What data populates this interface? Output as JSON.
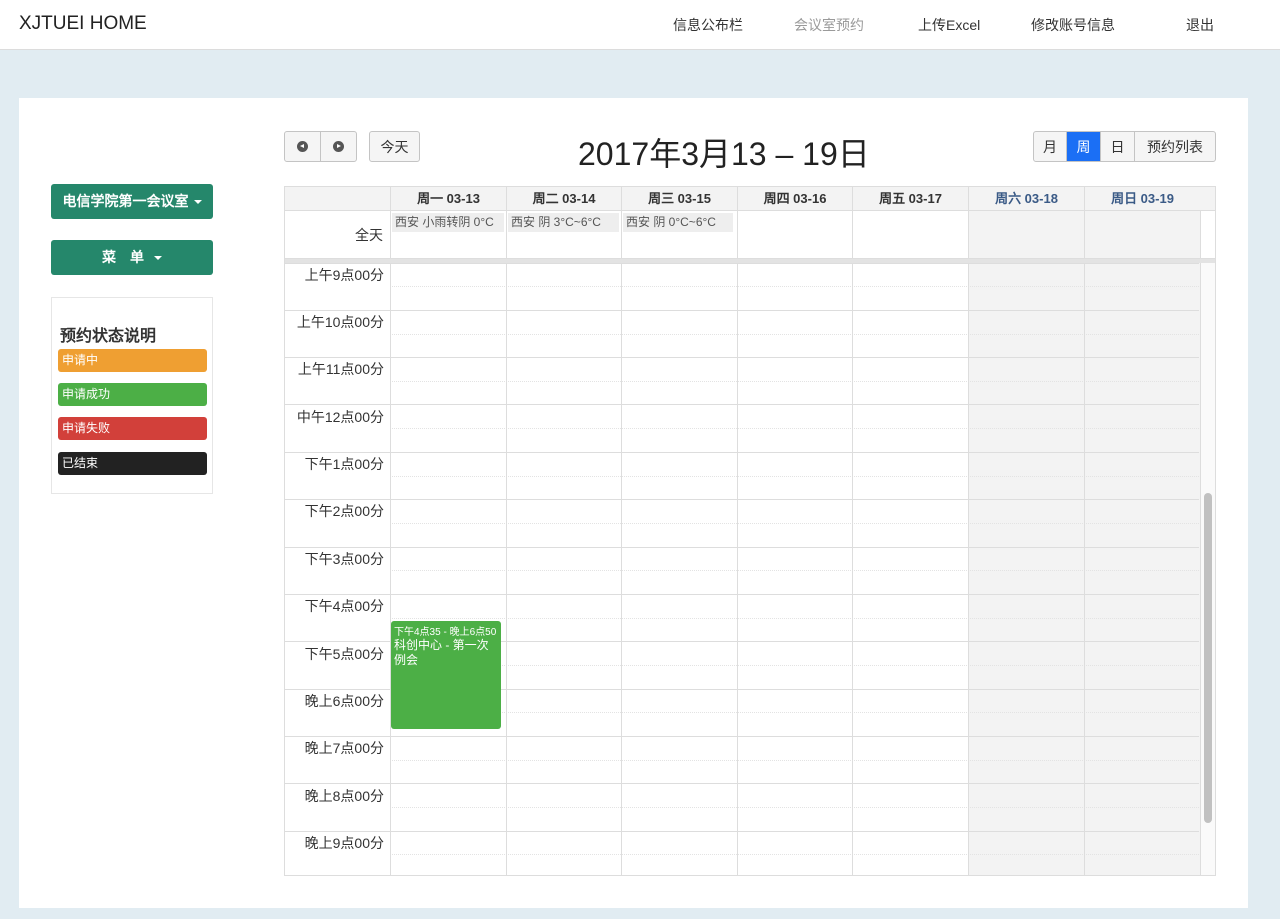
{
  "navbar": {
    "brand": "XJTUEI HOME",
    "items": [
      {
        "label": "信息公布栏",
        "active": false
      },
      {
        "label": "会议室预约",
        "active": true
      },
      {
        "label": "上传Excel",
        "active": false
      },
      {
        "label": "修改账号信息",
        "active": false
      },
      {
        "label": "退出",
        "active": false
      }
    ]
  },
  "sidebar": {
    "room_dropdown": "电信学院第一会议室",
    "menu_dropdown": "菜　单",
    "legend": {
      "title": "预约状态说明",
      "items": [
        {
          "label": "申请中",
          "color": "#ef9f32"
        },
        {
          "label": "申请成功",
          "color": "#4caf46"
        },
        {
          "label": "申请失败",
          "color": "#d2403a"
        },
        {
          "label": "已结束",
          "color": "#222222"
        }
      ]
    }
  },
  "toolbar": {
    "prev_icon": "prev-circle-icon",
    "next_icon": "next-circle-icon",
    "today": "今天",
    "title": "2017年3月13 – 19日",
    "views": [
      {
        "label": "月",
        "active": false
      },
      {
        "label": "周",
        "active": true
      },
      {
        "label": "日",
        "active": false
      },
      {
        "label": "预约列表",
        "active": false
      }
    ]
  },
  "calendar": {
    "days": [
      {
        "label": "周一 03-13",
        "weekend": false,
        "weather": "西安 小雨转阴 0°C"
      },
      {
        "label": "周二 03-14",
        "weekend": false,
        "weather": "西安 阴 3°C~6°C"
      },
      {
        "label": "周三 03-15",
        "weekend": false,
        "weather": "西安 阴 0°C~6°C"
      },
      {
        "label": "周四 03-16",
        "weekend": false,
        "weather": ""
      },
      {
        "label": "周五 03-17",
        "weekend": false,
        "weather": ""
      },
      {
        "label": "周六 03-18",
        "weekend": true,
        "weather": ""
      },
      {
        "label": "周日 03-19",
        "weekend": true,
        "weather": ""
      }
    ],
    "allday_label": "全天",
    "hours": [
      "上午9点00分",
      "上午10点00分",
      "上午11点00分",
      "中午12点00分",
      "下午1点00分",
      "下午2点00分",
      "下午3点00分",
      "下午4点00分",
      "下午5点00分",
      "晚上6点00分",
      "晚上7点00分",
      "晚上8点00分",
      "晚上9点00分"
    ],
    "events": [
      {
        "time": "下午4点35 - 晚上6点50",
        "title": "科创中心 - 第一次例会",
        "status": "申请成功",
        "color": "#4caf46"
      }
    ]
  }
}
